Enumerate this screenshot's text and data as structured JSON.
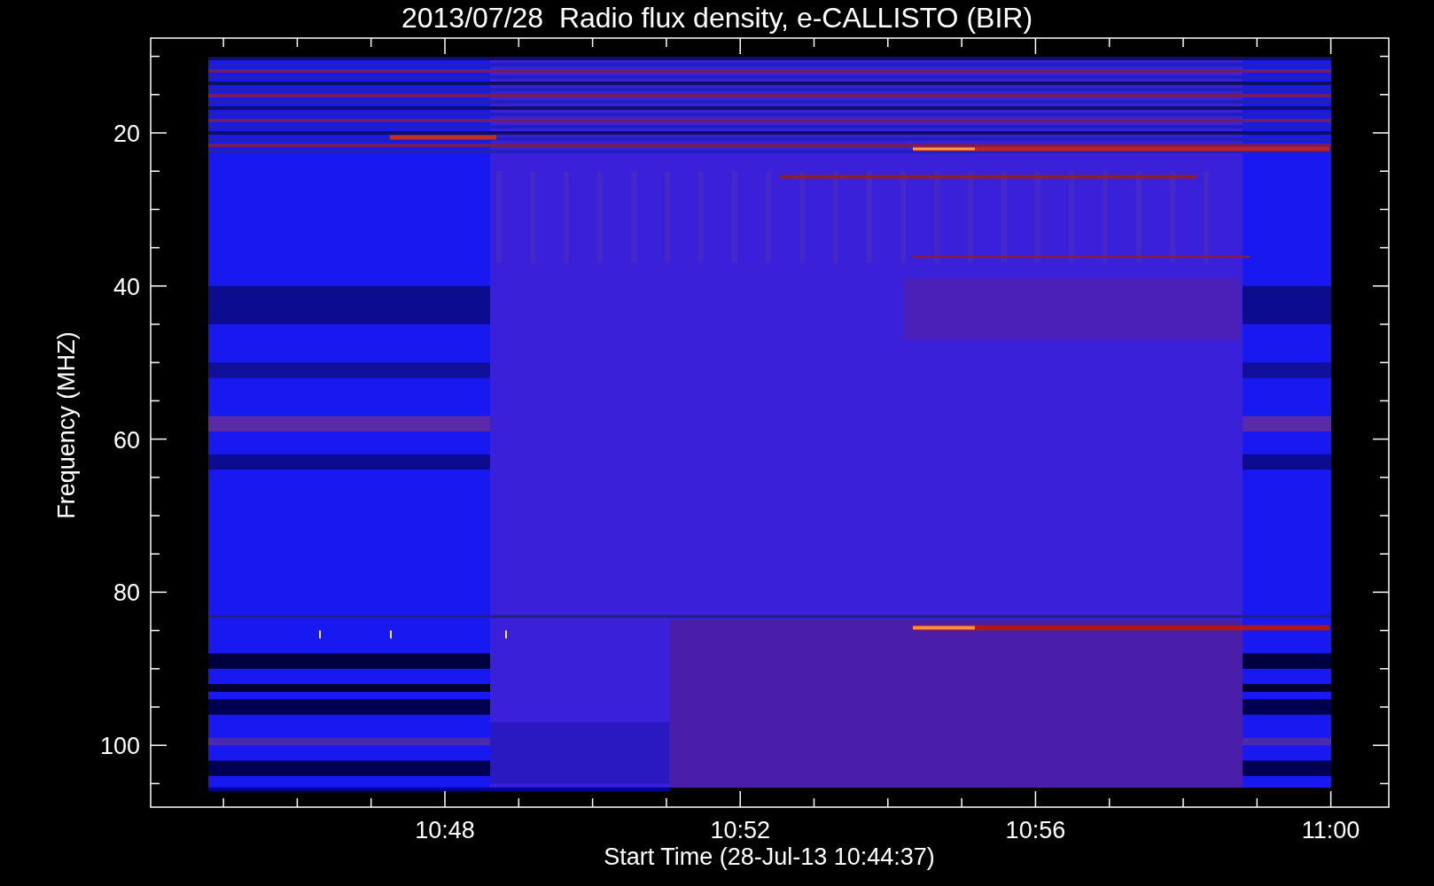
{
  "title": "2013/07/28  Radio flux density, e-CALLISTO (BIR)",
  "y_axis": {
    "label": "Frequency (MHZ)",
    "ticks": [
      "20",
      "40",
      "60",
      "80",
      "100"
    ]
  },
  "x_axis": {
    "label": "Start Time (28-Jul-13 10:44:37)",
    "ticks": [
      "10:48",
      "10:52",
      "10:56",
      "11:00"
    ]
  }
}
